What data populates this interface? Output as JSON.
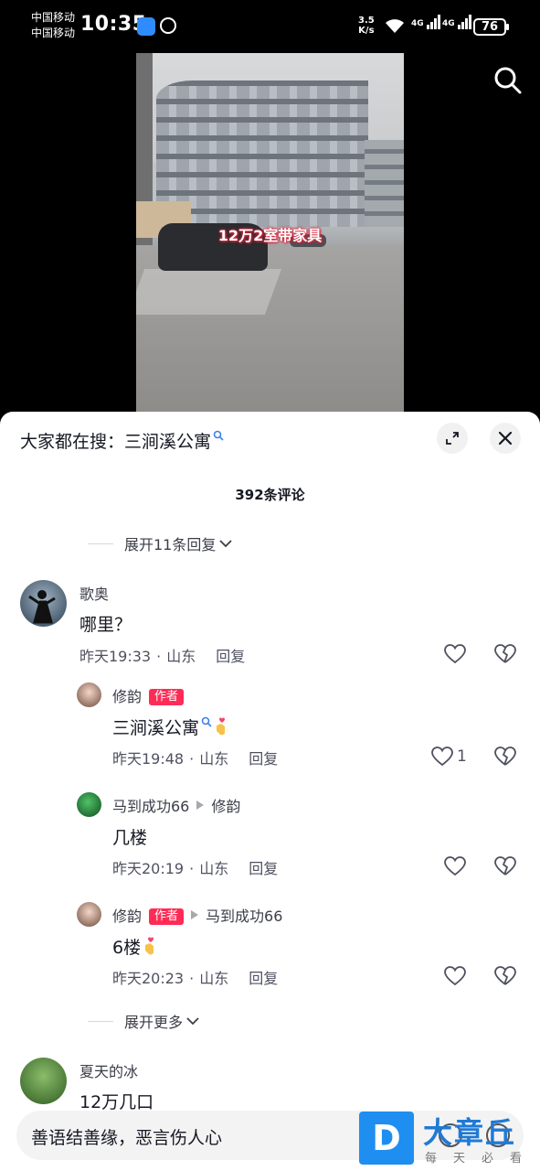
{
  "status_bar": {
    "carrier1": "中国移动",
    "carrier2": "中国移动",
    "time": "10:35",
    "net_speed_value": "3.5",
    "net_speed_unit": "K/s",
    "signal1": "4G",
    "signal2": "4G",
    "battery": "76"
  },
  "video": {
    "caption": "12万2室带家具",
    "search_icon": "search-icon"
  },
  "sheet": {
    "hot_search_prefix": "大家都在搜：",
    "hot_search_keyword": "三涧溪公寓",
    "comment_count": "392条评论",
    "expand_top": "展开11条回复",
    "expand_more": "展开更多"
  },
  "comments": {
    "c1": {
      "name": "歌奥",
      "text": "哪里？",
      "time": "昨天19:33",
      "location": "山东",
      "reply": "回复"
    },
    "r1": {
      "name": "修韵",
      "badge": "作者",
      "text": "三涧溪公寓",
      "time": "昨天19:48",
      "location": "山东",
      "reply": "回复",
      "likes": "1"
    },
    "r2": {
      "name": "马到成功66",
      "reply_to": "修韵",
      "text": "几楼",
      "time": "昨天20:19",
      "location": "山东",
      "reply": "回复"
    },
    "r3": {
      "name": "修韵",
      "badge": "作者",
      "reply_to": "马到成功66",
      "text": "6楼",
      "time": "昨天20:23",
      "location": "山东",
      "reply": "回复"
    },
    "c2": {
      "name": "夏天的冰",
      "text": "12万几口"
    }
  },
  "input": {
    "placeholder": "善语结善缘，恶言伤人心"
  },
  "watermark": {
    "logo": "D",
    "title": "大章丘",
    "subtitle": "每天必看"
  },
  "colors": {
    "accent": "#fe2c55",
    "text_primary": "#161823",
    "text_secondary": "#4f5160"
  }
}
